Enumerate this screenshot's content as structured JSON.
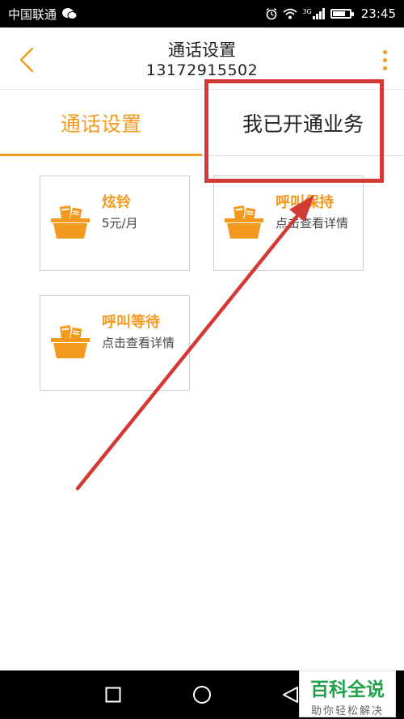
{
  "status_bar": {
    "carrier": "中国联通",
    "network": "3G",
    "time": "23:45"
  },
  "header": {
    "title": "通话设置",
    "phone_number": "13172915502"
  },
  "tabs": [
    {
      "label": "通话设置",
      "active": true
    },
    {
      "label": "我已开通业务",
      "active": false
    }
  ],
  "cards": [
    {
      "title": "炫铃",
      "subtitle": "5元/月"
    },
    {
      "title": "呼叫保持",
      "subtitle": "点击查看详情"
    },
    {
      "title": "呼叫等待",
      "subtitle": "点击查看详情"
    }
  ],
  "watermark": {
    "main": "百科全说",
    "sub": "助你轻松解决"
  },
  "colors": {
    "accent": "#f39a1e",
    "annotation_red": "#d23b35",
    "watermark_green": "#21a24a"
  }
}
